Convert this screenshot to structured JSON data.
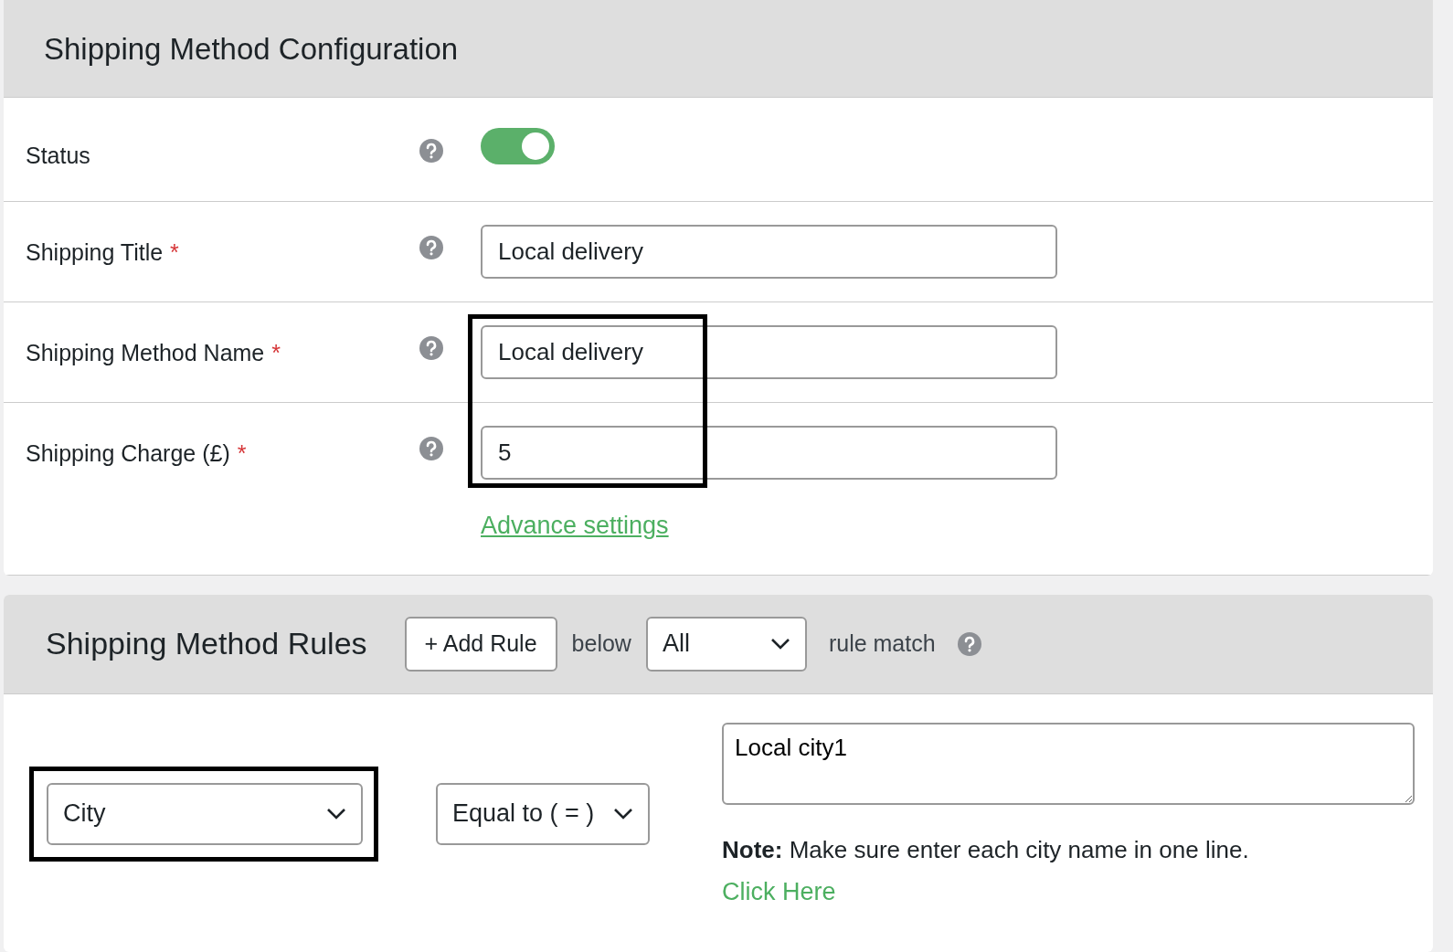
{
  "config": {
    "title": "Shipping Method Configuration",
    "rows": [
      {
        "kind": "toggle",
        "label": "Status",
        "on": true
      },
      {
        "kind": "text",
        "label": "Shipping Title",
        "required_mark": "*",
        "value": "Local delivery",
        "highlighted": false
      },
      {
        "kind": "text",
        "label": "Shipping Method Name",
        "required_mark": "*",
        "value": "Local delivery",
        "highlighted": true
      },
      {
        "kind": "text",
        "label": "Shipping Charge (£)",
        "required_mark": "*",
        "value": "5",
        "highlighted": true,
        "link": "Advance settings"
      }
    ]
  },
  "rules": {
    "title": "Shipping Method Rules",
    "add_button": "+ Add Rule",
    "below_text": "below",
    "match_select": "All",
    "match_text": "rule match",
    "rule": {
      "field": "City",
      "field_highlighted": true,
      "operator": "Equal to ( = )",
      "value": "Local city1",
      "note": "**Note:** Make sure enter each city name in one line.",
      "link": "Click Here"
    }
  }
}
